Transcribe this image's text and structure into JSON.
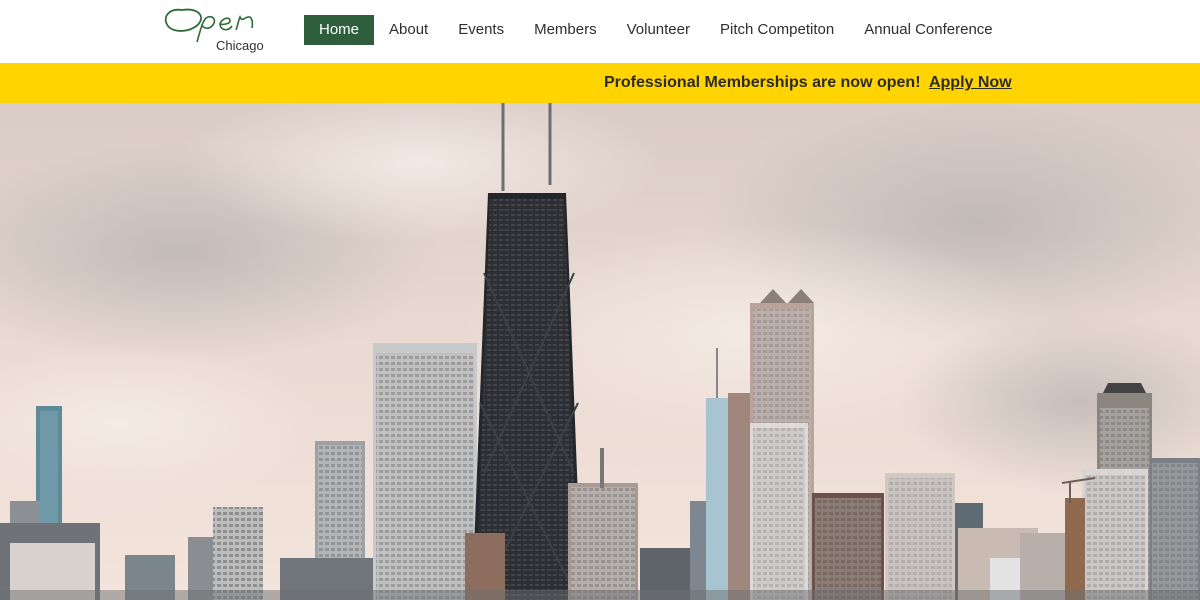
{
  "logo": {
    "wordmark": "Open",
    "subtitle": "Chicago",
    "accent_color": "#2e6b3a"
  },
  "nav": {
    "items": [
      {
        "label": "Home",
        "active": true
      },
      {
        "label": "About",
        "active": false
      },
      {
        "label": "Events",
        "active": false
      },
      {
        "label": "Members",
        "active": false
      },
      {
        "label": "Volunteer",
        "active": false
      },
      {
        "label": "Pitch Competiton",
        "active": false
      },
      {
        "label": "Annual Conference",
        "active": false
      }
    ],
    "active_color": "#2e5e3b"
  },
  "banner": {
    "text": "Professional Memberships are now open!",
    "link_label": "Apply Now",
    "background_color": "#ffd400"
  },
  "hero": {
    "subject": "chicago-skyline-photo",
    "sky_color": "#e6d5cf"
  }
}
